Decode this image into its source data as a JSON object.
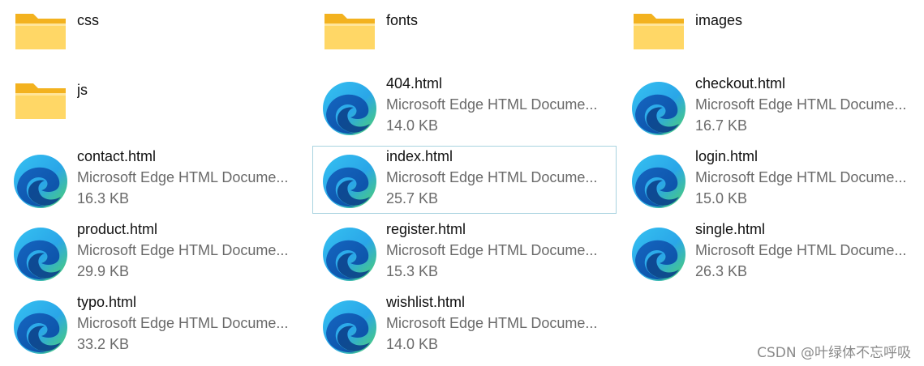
{
  "icons": {
    "folder": "folder-icon",
    "file": "edge-html-file-icon"
  },
  "colors": {
    "folder_front": "#ffd766",
    "folder_back": "#f3b21f",
    "edge_blue_dark": "#0b4fa3",
    "edge_blue_light": "#2aa6e8",
    "edge_green": "#4fd36a",
    "selection_border": "#a9d3e0"
  },
  "files": [
    {
      "name": "css",
      "kind": "folder"
    },
    {
      "name": "fonts",
      "kind": "folder"
    },
    {
      "name": "images",
      "kind": "folder"
    },
    {
      "name": "js",
      "kind": "folder"
    },
    {
      "name": "404.html",
      "kind": "file",
      "type": "Microsoft Edge HTML Docume...",
      "size": "14.0 KB"
    },
    {
      "name": "checkout.html",
      "kind": "file",
      "type": "Microsoft Edge HTML Docume...",
      "size": "16.7 KB"
    },
    {
      "name": "contact.html",
      "kind": "file",
      "type": "Microsoft Edge HTML Docume...",
      "size": "16.3 KB"
    },
    {
      "name": "index.html",
      "kind": "file",
      "type": "Microsoft Edge HTML Docume...",
      "size": "25.7 KB",
      "selected": true
    },
    {
      "name": "login.html",
      "kind": "file",
      "type": "Microsoft Edge HTML Docume...",
      "size": "15.0 KB"
    },
    {
      "name": "product.html",
      "kind": "file",
      "type": "Microsoft Edge HTML Docume...",
      "size": "29.9 KB"
    },
    {
      "name": "register.html",
      "kind": "file",
      "type": "Microsoft Edge HTML Docume...",
      "size": "15.3 KB"
    },
    {
      "name": "single.html",
      "kind": "file",
      "type": "Microsoft Edge HTML Docume...",
      "size": "26.3 KB"
    },
    {
      "name": "typo.html",
      "kind": "file",
      "type": "Microsoft Edge HTML Docume...",
      "size": "33.2 KB"
    },
    {
      "name": "wishlist.html",
      "kind": "file",
      "type": "Microsoft Edge HTML Docume...",
      "size": "14.0 KB"
    }
  ],
  "watermark": "CSDN @叶绿体不忘呼吸"
}
